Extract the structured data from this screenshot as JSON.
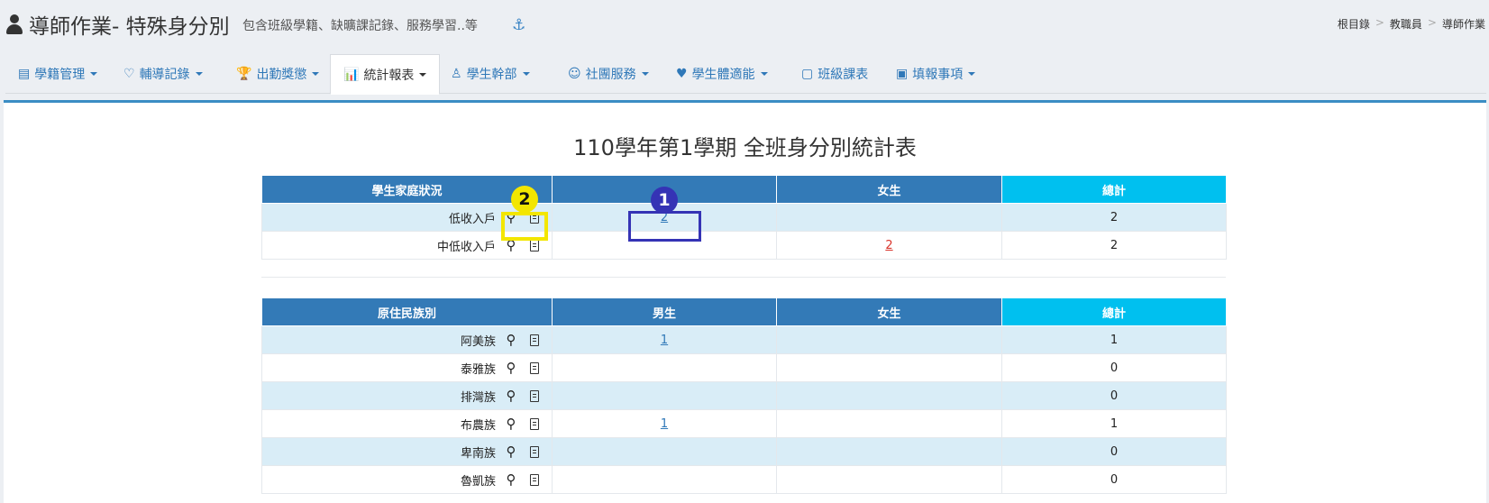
{
  "header": {
    "title": "導師作業- 特殊身分別",
    "subtitle": "包含班級學籍、缺曠課記錄、服務學習..等",
    "anchor_glyph": "⚓",
    "breadcrumb": [
      "根目錄",
      "教職員",
      "導師作業"
    ],
    "breadcrumb_sep": ">"
  },
  "tabs": [
    {
      "label": "學籍管理",
      "icon": "id-card-icon",
      "glyph": "▤",
      "dropdown": true,
      "active": false
    },
    {
      "label": "輔導記錄",
      "icon": "heart-icon",
      "glyph": "♡",
      "dropdown": true,
      "active": false
    },
    {
      "label": "出勤獎懲",
      "icon": "trophy-icon",
      "glyph": "🏆",
      "dropdown": true,
      "active": false
    },
    {
      "label": "統計報表",
      "icon": "bar-chart-icon",
      "glyph": "📊",
      "dropdown": true,
      "active": true
    },
    {
      "label": "學生幹部",
      "icon": "person-icon",
      "glyph": "♙",
      "dropdown": true,
      "active": false
    },
    {
      "label": "社團服務",
      "icon": "group-icon",
      "glyph": "☺",
      "dropdown": true,
      "active": false
    },
    {
      "label": "學生體適能",
      "icon": "heartbeat-icon",
      "glyph": "♥",
      "dropdown": true,
      "active": false
    },
    {
      "label": "班級課表",
      "icon": "note-icon",
      "glyph": "▢",
      "dropdown": false,
      "active": false
    },
    {
      "label": "填報事項",
      "icon": "form-icon",
      "glyph": "▣",
      "dropdown": true,
      "active": false
    }
  ],
  "report": {
    "title": "110學年第1學期 全班身分別統計表",
    "columns": {
      "male": "男生",
      "female": "女生",
      "total": "總計"
    },
    "family_table": {
      "header": "學生家庭狀況",
      "male_header_shown": "",
      "rows": [
        {
          "label": "低收入戶",
          "male": "2",
          "female": "",
          "total": "2"
        },
        {
          "label": "中低收入戶",
          "male": "",
          "female": "2",
          "total": "2"
        }
      ]
    },
    "aboriginal_table": {
      "header": "原住民族別",
      "rows": [
        {
          "label": "阿美族",
          "male": "1",
          "female": "",
          "total": "1"
        },
        {
          "label": "泰雅族",
          "male": "",
          "female": "",
          "total": "0"
        },
        {
          "label": "排灣族",
          "male": "",
          "female": "",
          "total": "0"
        },
        {
          "label": "布農族",
          "male": "1",
          "female": "",
          "total": "1"
        },
        {
          "label": "卑南族",
          "male": "",
          "female": "",
          "total": "0"
        },
        {
          "label": "魯凱族",
          "male": "",
          "female": "",
          "total": "0"
        }
      ]
    }
  },
  "annotations": {
    "badge_1": "1",
    "badge_2": "2",
    "highlight_yellow": "#f3e600",
    "highlight_blue": "#3533b5"
  },
  "colors": {
    "header_blue": "#337ab7",
    "total_cyan": "#00c0ef",
    "row_stripe": "#d9edf7",
    "link_blue": "#2f78b8",
    "link_red": "#d9342b",
    "panel_top": "#3b8dc4"
  }
}
